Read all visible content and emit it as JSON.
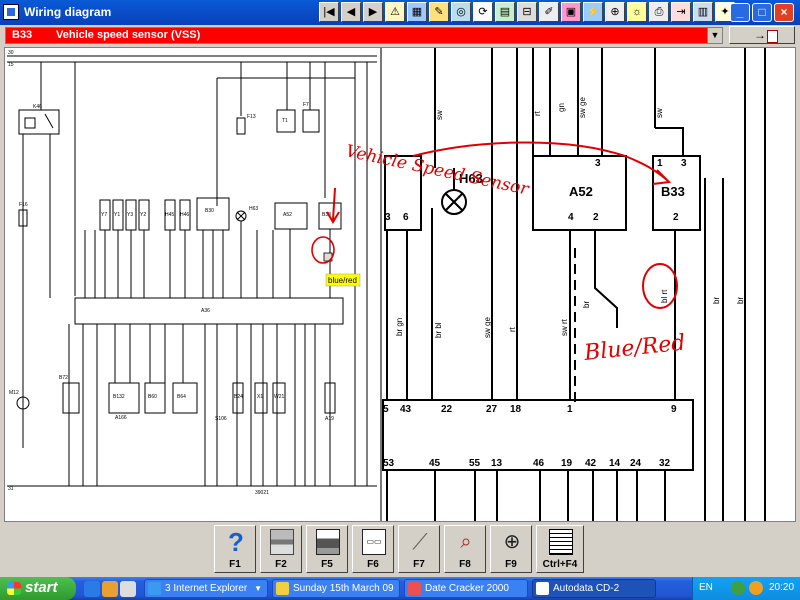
{
  "window": {
    "title": "Wiring diagram"
  },
  "toolbar": {
    "buttons": [
      "first-page",
      "previous-page",
      "next-page",
      "last-page",
      "warning",
      "component-location",
      "rename",
      "fuse",
      "rotate",
      "colour",
      "sheets",
      "edit",
      "book",
      "wiring",
      "zoom",
      "world",
      "print",
      "exit"
    ]
  },
  "component": {
    "code": "B33",
    "name": "Vehicle speed sensor (VSS)"
  },
  "overview": {
    "top_rail": [
      "30",
      "15"
    ],
    "bottom_rail": "31",
    "relay": "K46",
    "fuses": [
      "F16",
      "F13",
      "F7",
      "M12"
    ],
    "parts": [
      "Y7",
      "Y1",
      "Y3",
      "Y2",
      "H45",
      "H46",
      "B30",
      "H63",
      "T1",
      "A52",
      "B33",
      "B72",
      "B132",
      "B60",
      "B64",
      "S106",
      "B24",
      "X1",
      "W21",
      "A19",
      "A166"
    ],
    "ecu_label": "A36",
    "ground_label": "39021",
    "tag": "blue/red"
  },
  "zoom": {
    "wire_labels": [
      "sw",
      "rt",
      "gn",
      "sw ge",
      "sw",
      "br gn",
      "br bl",
      "sw ge",
      "rt",
      "sw rt",
      "br",
      "bl rt",
      "br",
      "br"
    ],
    "h63": {
      "label": "H63",
      "pins": [
        "3",
        "6"
      ]
    },
    "a52": {
      "label": "A52",
      "pin_top": "3",
      "pins": [
        "4",
        "2"
      ]
    },
    "b33": {
      "label": "B33",
      "pins_top": [
        "1",
        "3"
      ],
      "pin_bottom": "2"
    },
    "ecu_top_pins": [
      "5",
      "43",
      "22",
      "27",
      "18",
      "1",
      "9"
    ],
    "ecu_bottom_pins": [
      "53",
      "45",
      "55",
      "13",
      "46",
      "19",
      "42",
      "14",
      "24",
      "32"
    ]
  },
  "annotations": {
    "handwritten_1": "Vehicle Speed Sensor",
    "handwritten_2": "Blue/Red"
  },
  "fkeys": [
    {
      "key": "F1",
      "icon": "help-icon"
    },
    {
      "key": "F2",
      "icon": "print-icon"
    },
    {
      "key": "F5",
      "icon": "printer-icon"
    },
    {
      "key": "F6",
      "icon": "connector-icon"
    },
    {
      "key": "F7",
      "icon": "probe-icon"
    },
    {
      "key": "F8",
      "icon": "search-component-icon"
    },
    {
      "key": "F9",
      "icon": "zoom-icon"
    },
    {
      "key": "Ctrl+F4",
      "icon": "grid-icon"
    }
  ],
  "taskbar": {
    "start_label": "start",
    "tasks": [
      {
        "label": "3 Internet Explorer",
        "grouped": true
      },
      {
        "label": "Sunday 15th March 09",
        "grouped": false
      },
      {
        "label": "Date Cracker 2000",
        "grouped": false
      },
      {
        "label": "Autodata CD-2",
        "grouped": false,
        "active": true
      }
    ],
    "language": "EN",
    "clock": "20:20"
  },
  "colors": {
    "titlebar": "#0a5ad6",
    "component_bar": "#ff0000",
    "annotation": "#e00000",
    "tag": "#ffff00"
  }
}
